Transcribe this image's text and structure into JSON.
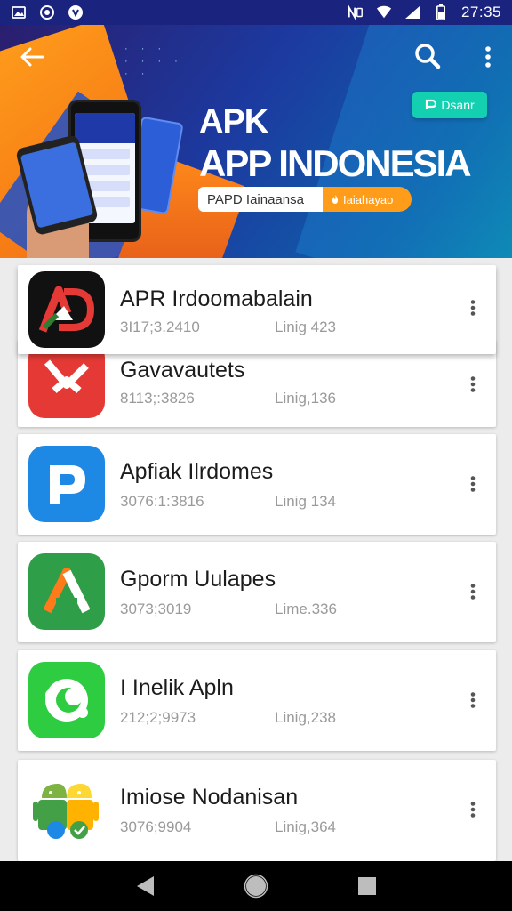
{
  "status_bar": {
    "time": "27:35",
    "left_icons": [
      "gallery-icon",
      "sync-icon",
      "notification-icon"
    ],
    "right_icons": [
      "nfc-icon",
      "wifi-icon",
      "signal-icon",
      "battery-icon"
    ]
  },
  "header": {
    "title_line1": "APK",
    "title_line2": "APP INDONESIA",
    "pill_text": "PAPD Iainaansa",
    "pill_badge_text": "Iaiahayao",
    "action_badge_label": "Dsanr",
    "colors": {
      "banner": "#1c3aa0",
      "accent_orange": "#ff9c1a",
      "accent_teal": "#13d0b0"
    }
  },
  "apps": [
    {
      "name": "APR Irdoomabalain",
      "size": "3I17;3.2410",
      "lang": "Linig 423",
      "icon": "ad-logo-icon"
    },
    {
      "name": "Gavavautets",
      "size": "8113;:3826",
      "lang": "Linig,136",
      "icon": "red-arrow-app-icon"
    },
    {
      "name": "Apfiak Ilrdomes",
      "size": "3076:1:3816",
      "lang": "Linig 134",
      "icon": "blue-p-app-icon"
    },
    {
      "name": "Gporm Uulapes",
      "size": "3073;3019",
      "lang": "Lime.336",
      "icon": "green-a-app-icon"
    },
    {
      "name": "I Inelik Apln",
      "size": "212;2;9973",
      "lang": "Linig,238",
      "icon": "green-chat-app-icon"
    },
    {
      "name": "Imiose Nodanisan",
      "size": "3076;9904",
      "lang": "Linig,364",
      "icon": "android-robot-app-icon"
    }
  ],
  "nav_bar": {
    "buttons": [
      "back-triangle-icon",
      "home-circle-icon",
      "recents-square-icon"
    ]
  }
}
